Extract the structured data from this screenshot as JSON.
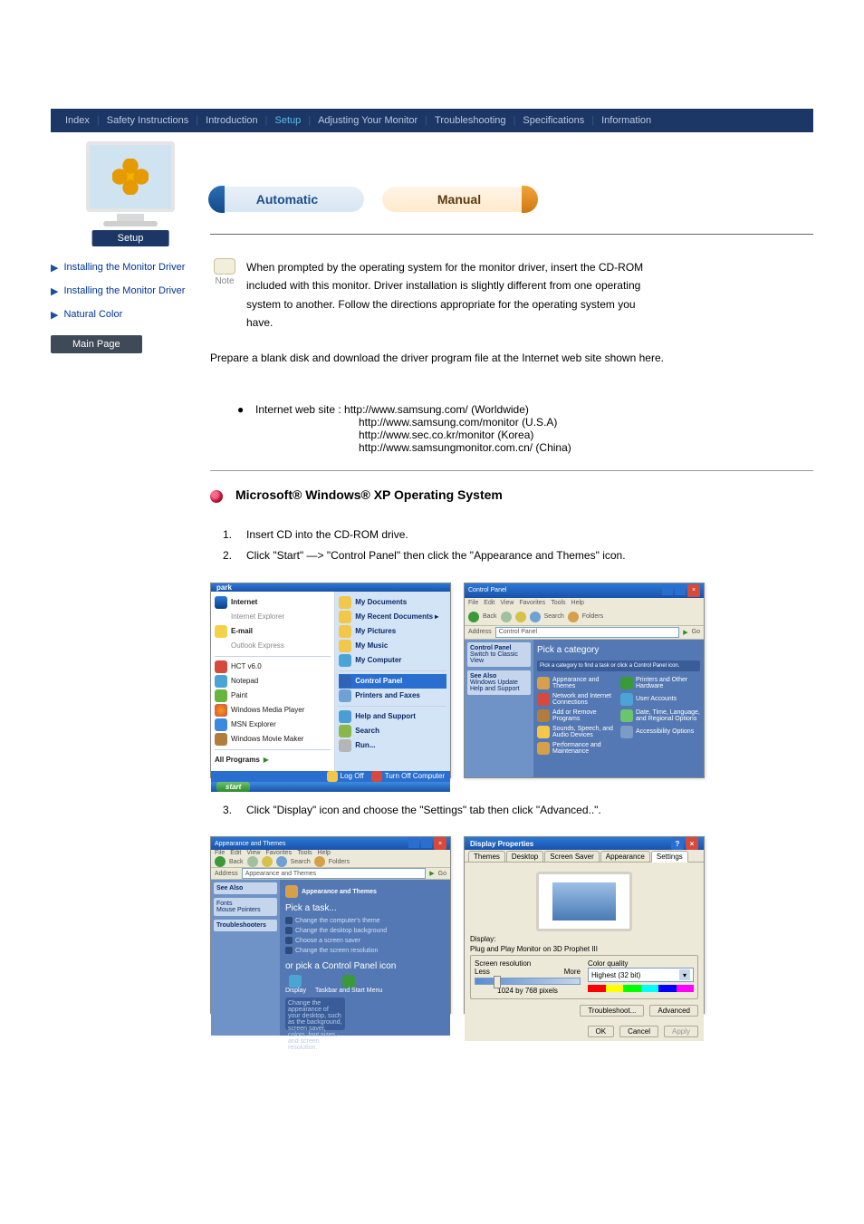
{
  "nav": {
    "items": [
      "Index",
      "Safety Instructions",
      "Introduction",
      "Setup",
      "Adjusting Your Monitor",
      "Troubleshooting",
      "Specifications",
      "Information"
    ],
    "highlight_index": 3
  },
  "monitor_label": "Setup",
  "sidebar": {
    "items": [
      "Installing the Monitor Driver",
      "Installing the Monitor Driver",
      "Natural Color"
    ],
    "main_page": "Main Page"
  },
  "pills": {
    "automatic": "Automatic",
    "manual": "Manual"
  },
  "note": {
    "label": "Note",
    "lines": [
      "When prompted by the operating system for the monitor driver, insert the CD-ROM",
      "included with this monitor. Driver installation is slightly different from one operating",
      "system to another. Follow the directions appropriate for the operating system you",
      "have."
    ]
  },
  "prepare": {
    "intro": "Prepare a blank disk and download the driver program file at the Internet web site shown here.",
    "bullet": "Internet web site : http://www.samsung.com/ (Worldwide)",
    "lines": [
      "http://www.samsung.com/monitor (U.S.A)",
      "http://www.sec.co.kr/monitor (Korea)",
      "http://www.samsungmonitor.com.cn/ (China)"
    ]
  },
  "os_section": {
    "title": "Microsoft® Windows® XP Operating System"
  },
  "steps": [
    "Insert CD into the CD-ROM drive.",
    "Click \"Start\" —> \"Control Panel\" then click the \"Appearance and Themes\" icon.",
    "Click \"Display\" icon and choose the \"Settings\" tab then click \"Advanced..\"."
  ],
  "start_menu": {
    "user": "park",
    "left": [
      "Internet",
      "Internet Explorer",
      "E-mail",
      "Outlook Express",
      "HCT v6.0",
      "Notepad",
      "Paint",
      "Windows Media Player",
      "MSN Explorer",
      "Windows Movie Maker",
      "All Programs"
    ],
    "right": [
      "My Documents",
      "My Recent Documents",
      "My Pictures",
      "My Music",
      "My Computer",
      "Control Panel",
      "Printers and Faxes",
      "Help and Support",
      "Search",
      "Run..."
    ],
    "highlight": "Control Panel",
    "logoff": "Log Off",
    "turnoff": "Turn Off Computer",
    "start": "start"
  },
  "cp_window": {
    "title": "Control Panel",
    "menus": [
      "File",
      "Edit",
      "View",
      "Favorites",
      "Tools",
      "Help"
    ],
    "back": "Back",
    "search": "Search",
    "folders": "Folders",
    "address_label": "Address",
    "address_value": "Control Panel",
    "go": "Go",
    "left_box_title": "Control Panel",
    "left_link": "Switch to Classic View",
    "see_also": "See Also",
    "see_links": [
      "Windows Update",
      "Help and Support"
    ],
    "pick": "Pick a category",
    "hint": "Pick a category to find a task or click a Control Panel icon.",
    "cats": [
      "Appearance and Themes",
      "Printers and Other Hardware",
      "Network and Internet Connections",
      "User Accounts",
      "Add or Remove Programs",
      "Date, Time, Language, and Regional Options",
      "Sounds, Speech, and Audio Devices",
      "Accessibility Options",
      "Performance and Maintenance",
      ""
    ]
  },
  "app_window": {
    "title": "Appearance and Themes",
    "pick": "Pick a task...",
    "tasks": [
      "Change the computer's theme",
      "Change the desktop background",
      "Choose a screen saver",
      "Change the screen resolution"
    ],
    "or": "or pick a Control Panel icon",
    "icons": [
      "Display",
      "Taskbar and Start Menu"
    ],
    "tip": "Change the appearance of your desktop, such as the background, screen saver, colors, font sizes, and screen resolution."
  },
  "disp_window": {
    "title": "Display Properties",
    "tabs": [
      "Themes",
      "Desktop",
      "Screen Saver",
      "Appearance",
      "Settings"
    ],
    "active_tab": "Settings",
    "display_label": "Display:",
    "display_value": "Plug and Play Monitor on 3D Prophet III",
    "res_group": "Screen resolution",
    "less": "Less",
    "more": "More",
    "res_value": "1024 by 768 pixels",
    "color_group": "Color quality",
    "color_value": "Highest (32 bit)",
    "trouble": "Troubleshoot...",
    "advanced": "Advanced",
    "ok": "OK",
    "cancel": "Cancel",
    "apply": "Apply"
  }
}
